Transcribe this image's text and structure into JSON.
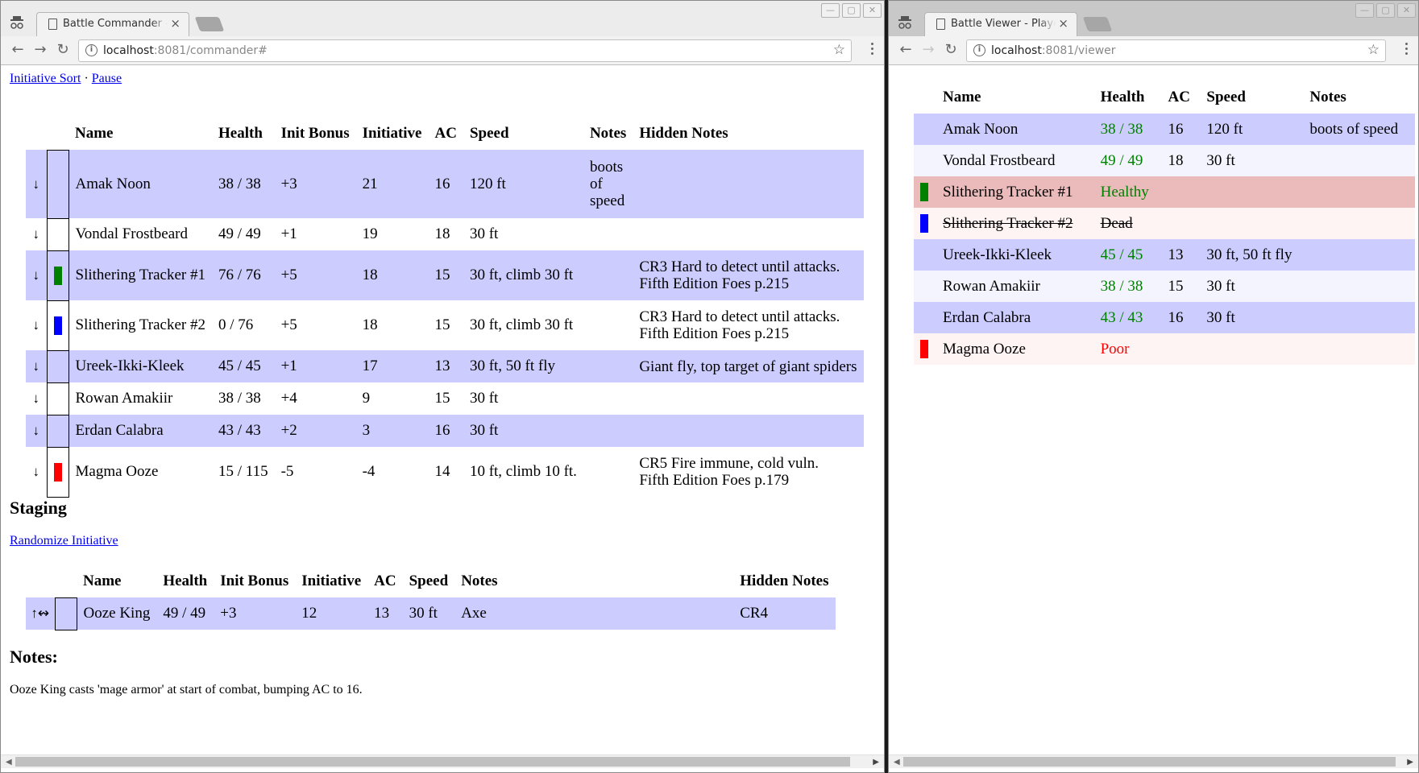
{
  "left_window": {
    "tab_title": "Battle Commander - C",
    "tab_close": "×",
    "url_host": "localhost",
    "url_rest": ":8081/commander#",
    "window_controls": [
      "—",
      "▢",
      "✕"
    ],
    "links": {
      "initiative_sort": "Initiative Sort",
      "separator": "·",
      "pause": "Pause"
    },
    "main_table": {
      "headers": [
        "",
        "",
        "Name",
        "Health",
        "Init Bonus",
        "Initiative",
        "AC",
        "Speed",
        "Notes",
        "Hidden Notes"
      ],
      "rows": [
        {
          "arrow": "↓",
          "marker": "",
          "name": "Amak Noon",
          "health": "38 / 38",
          "init_bonus": "+3",
          "initiative": "21",
          "ac": "16",
          "speed": "120 ft",
          "notes": "boots of speed",
          "hidden_notes": "",
          "shade": "even"
        },
        {
          "arrow": "↓",
          "marker": "",
          "name": "Vondal Frostbeard",
          "health": "49 / 49",
          "init_bonus": "+1",
          "initiative": "19",
          "ac": "18",
          "speed": "30 ft",
          "notes": "",
          "hidden_notes": "",
          "shade": "odd"
        },
        {
          "arrow": "↓",
          "marker": "#008000",
          "name": "Slithering Tracker #1",
          "health": "76 / 76",
          "init_bonus": "+5",
          "initiative": "18",
          "ac": "15",
          "speed": "30 ft, climb 30 ft",
          "notes": "",
          "hidden_notes": "CR3 Hard to detect until attacks.",
          "hidden_notes_2": "Fifth Edition Foes p.215",
          "shade": "even"
        },
        {
          "arrow": "↓",
          "marker": "#0000ff",
          "name": "Slithering Tracker #2",
          "health": "0 / 76",
          "init_bonus": "+5",
          "initiative": "18",
          "ac": "15",
          "speed": "30 ft, climb 30 ft",
          "notes": "",
          "hidden_notes": "CR3 Hard to detect until attacks.",
          "hidden_notes_2": "Fifth Edition Foes p.215",
          "shade": "odd"
        },
        {
          "arrow": "↓",
          "marker": "",
          "name": "Ureek-Ikki-Kleek",
          "health": "45 / 45",
          "init_bonus": "+1",
          "initiative": "17",
          "ac": "13",
          "speed": "30 ft, 50 ft fly",
          "notes": "",
          "hidden_notes": "Giant fly, top target of giant spiders",
          "shade": "even"
        },
        {
          "arrow": "↓",
          "marker": "",
          "name": "Rowan Amakiir",
          "health": "38 / 38",
          "init_bonus": "+4",
          "initiative": "9",
          "ac": "15",
          "speed": "30 ft",
          "notes": "",
          "hidden_notes": "",
          "shade": "odd"
        },
        {
          "arrow": "↓",
          "marker": "",
          "name": "Erdan Calabra",
          "health": "43 / 43",
          "init_bonus": "+2",
          "initiative": "3",
          "ac": "16",
          "speed": "30 ft",
          "notes": "",
          "hidden_notes": "",
          "shade": "even"
        },
        {
          "arrow": "↓",
          "marker": "#ff0000",
          "name": "Magma Ooze",
          "health": "15 / 115",
          "init_bonus": "-5",
          "initiative": "-4",
          "ac": "14",
          "speed": "10 ft, climb 10 ft.",
          "notes": "",
          "hidden_notes": "CR5 Fire immune, cold vuln.",
          "hidden_notes_2": "Fifth Edition Foes p.179",
          "shade": "odd"
        }
      ]
    },
    "staging": {
      "heading": "Staging",
      "randomize_link": "Randomize Initiative",
      "headers": [
        "",
        "",
        "Name",
        "Health",
        "Init Bonus",
        "Initiative",
        "AC",
        "Speed",
        "Notes",
        "Hidden Notes"
      ],
      "rows": [
        {
          "arrow": "↑↭",
          "name": "Ooze King",
          "health": "49 / 49",
          "init_bonus": "+3",
          "initiative": "12",
          "ac": "13",
          "speed": "30 ft",
          "notes": "Axe",
          "hidden_notes": "CR4"
        }
      ]
    },
    "notes": {
      "heading": "Notes:",
      "text": "Ooze King casts 'mage armor' at start of combat, bumping AC to 16."
    }
  },
  "right_window": {
    "tab_title": "Battle Viewer - Player",
    "tab_close": "×",
    "url_host": "localhost",
    "url_rest": ":8081/viewer",
    "window_controls": [
      "—",
      "▢",
      "✕"
    ],
    "table": {
      "headers": [
        "",
        "Name",
        "Health",
        "AC",
        "Speed",
        "Notes"
      ],
      "rows": [
        {
          "marker": "",
          "name": "Amak Noon",
          "health": "38 / 38",
          "health_status": "good",
          "ac": "16",
          "speed": "120 ft",
          "notes": "boots of speed",
          "shade": "even"
        },
        {
          "marker": "",
          "name": "Vondal Frostbeard",
          "health": "49 / 49",
          "health_status": "good",
          "ac": "18",
          "speed": "30 ft",
          "notes": "",
          "shade": "odd"
        },
        {
          "marker": "#008000",
          "name": "Slithering Tracker #1",
          "health": "Healthy",
          "health_status": "good",
          "ac": "",
          "speed": "",
          "notes": "",
          "shade": "hit"
        },
        {
          "marker": "#0000ff",
          "name": "Slithering Tracker #2",
          "health": "Dead",
          "health_status": "dead",
          "ac": "",
          "speed": "",
          "notes": "",
          "shade": "dead"
        },
        {
          "marker": "",
          "name": "Ureek-Ikki-Kleek",
          "health": "45 / 45",
          "health_status": "good",
          "ac": "13",
          "speed": "30 ft, 50 ft fly",
          "notes": "",
          "shade": "even"
        },
        {
          "marker": "",
          "name": "Rowan Amakiir",
          "health": "38 / 38",
          "health_status": "good",
          "ac": "15",
          "speed": "30 ft",
          "notes": "",
          "shade": "odd"
        },
        {
          "marker": "",
          "name": "Erdan Calabra",
          "health": "43 / 43",
          "health_status": "good",
          "ac": "16",
          "speed": "30 ft",
          "notes": "",
          "shade": "even"
        },
        {
          "marker": "#ff0000",
          "name": "Magma Ooze",
          "health": "Poor",
          "health_status": "poor",
          "ac": "",
          "speed": "",
          "notes": "",
          "shade": "poor"
        }
      ]
    }
  },
  "colors": {
    "row_even": "#ccccff",
    "row_odd_viewer": "#f4f4ff",
    "row_hit": "#ebbaba",
    "row_dead": "#fff4f4",
    "health_good": "#008000",
    "health_poor": "#ff0000",
    "link": "#0000ee"
  }
}
